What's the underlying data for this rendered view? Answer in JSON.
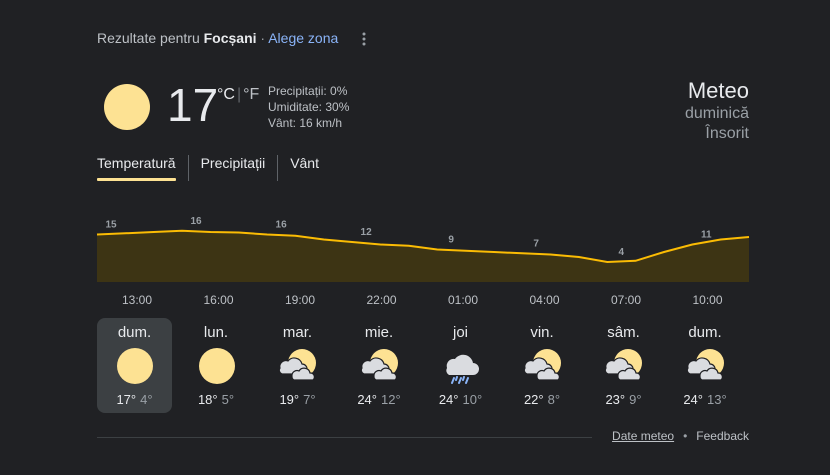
{
  "header": {
    "results_for": "Rezultate pentru",
    "location": "Focșani",
    "separator": "·",
    "choose_area": "Alege zona",
    "more_icon": "more-vert-icon"
  },
  "current": {
    "icon": "sun-icon",
    "temperature": "17",
    "unit_c": "°C",
    "unit_f": "°F",
    "precipitation": "Precipitații: 0%",
    "humidity": "Umiditate: 30%",
    "wind": "Vânt: 16 km/h"
  },
  "summary": {
    "title": "Meteo",
    "day": "duminică",
    "condition": "Însorit"
  },
  "tabs": [
    {
      "label": "Temperatură",
      "active": true
    },
    {
      "label": "Precipitații",
      "active": false
    },
    {
      "label": "Vânt",
      "active": false
    }
  ],
  "chart_data": {
    "type": "area",
    "labels": [
      "15",
      "16",
      "16",
      "12",
      "9",
      "7",
      "4",
      "11"
    ],
    "values": [
      15,
      15.5,
      16,
      16.5,
      16,
      15.8,
      15,
      14.5,
      13,
      12,
      11,
      10.5,
      9,
      8.5,
      8,
      7.5,
      7,
      6,
      4,
      4.5,
      8,
      11,
      13,
      14
    ],
    "label_indexes": [
      0,
      3,
      6,
      9,
      12,
      15,
      18,
      21
    ],
    "ylim": [
      -4,
      20
    ],
    "colors": {
      "line": "#fbbc04",
      "fill": "#3d3414"
    }
  },
  "times": [
    "13:00",
    "16:00",
    "19:00",
    "22:00",
    "01:00",
    "04:00",
    "07:00",
    "10:00"
  ],
  "days": [
    {
      "name": "dum.",
      "icon": "sunny-icon",
      "high": "17°",
      "low": "4°",
      "active": true
    },
    {
      "name": "lun.",
      "icon": "sunny-icon",
      "high": "18°",
      "low": "5°",
      "active": false
    },
    {
      "name": "mar.",
      "icon": "partly-cloudy-icon",
      "high": "19°",
      "low": "7°",
      "active": false
    },
    {
      "name": "mie.",
      "icon": "partly-cloudy-icon",
      "high": "24°",
      "low": "12°",
      "active": false
    },
    {
      "name": "joi",
      "icon": "rain-icon",
      "high": "24°",
      "low": "10°",
      "active": false
    },
    {
      "name": "vin.",
      "icon": "partly-cloudy-icon",
      "high": "22°",
      "low": "8°",
      "active": false
    },
    {
      "name": "sâm.",
      "icon": "partly-cloudy-icon",
      "high": "23°",
      "low": "9°",
      "active": false
    },
    {
      "name": "dum.",
      "icon": "partly-cloudy-icon",
      "high": "24°",
      "low": "13°",
      "active": false
    }
  ],
  "footer": {
    "weather_data": "Date meteo",
    "dot": "•",
    "feedback": "Feedback"
  }
}
